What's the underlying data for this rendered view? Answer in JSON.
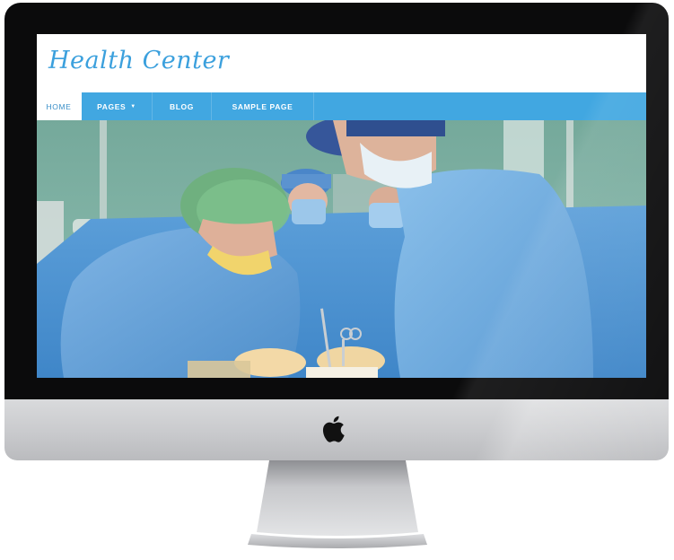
{
  "site": {
    "title": "Health Center"
  },
  "nav": {
    "items": [
      {
        "label": "HOME",
        "active": true
      },
      {
        "label": "PAGES",
        "has_dropdown": true,
        "caret": "▼"
      },
      {
        "label": "BLOG"
      },
      {
        "label": "SAMPLE PAGE"
      }
    ]
  },
  "colors": {
    "accent": "#41a7e1",
    "title": "#3ba0dd",
    "bezel": "#0b0b0c",
    "chin": "#cfd0d2"
  },
  "icons": {
    "brand": "apple-logo-icon",
    "caret": "caret-down-icon"
  }
}
